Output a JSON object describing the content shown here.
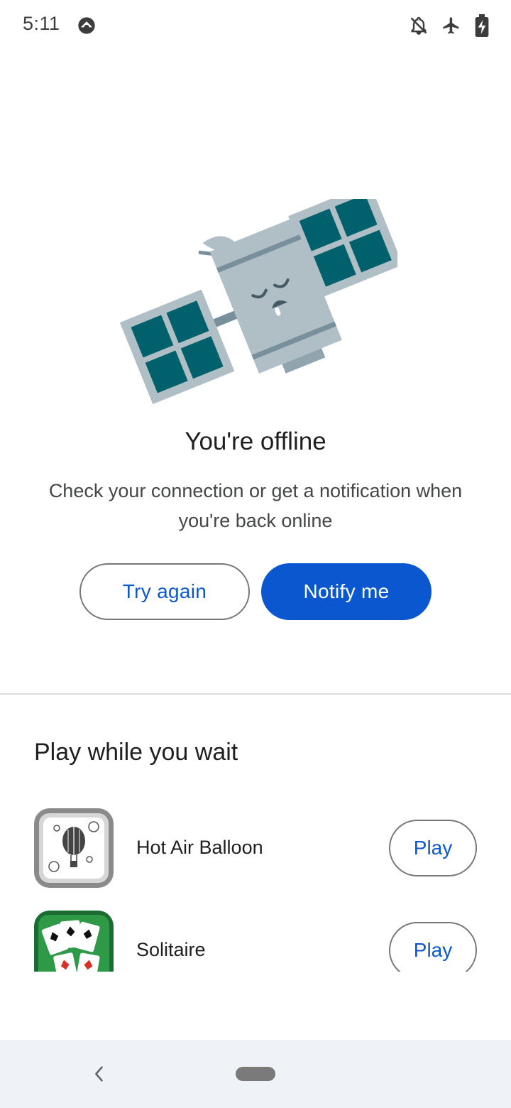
{
  "status_bar": {
    "time": "5:11",
    "left_icon": "data-saver-icon",
    "right_icons": [
      "notifications-off-icon",
      "airplane-mode-icon",
      "battery-charging-icon"
    ]
  },
  "offline": {
    "illustration": "sleeping-satellite-illustration",
    "title": "You're offline",
    "message": "Check your connection or get a notification when you're back online",
    "try_again_label": "Try again",
    "notify_label": "Notify me"
  },
  "games": {
    "section_title": "Play while you wait",
    "items": [
      {
        "name": "Hot Air Balloon",
        "play_label": "Play",
        "icon": "hot-air-balloon-icon"
      },
      {
        "name": "Solitaire",
        "play_label": "Play",
        "icon": "solitaire-icon"
      }
    ]
  },
  "nav": {
    "back_icon": "back-chevron-icon",
    "home_icon": "home-pill-icon"
  },
  "colors": {
    "accent": "#0b57d0",
    "satellite_body": "#b0bec5",
    "satellite_panel": "#00606b",
    "solitaire_green": "#1e7d3a"
  }
}
